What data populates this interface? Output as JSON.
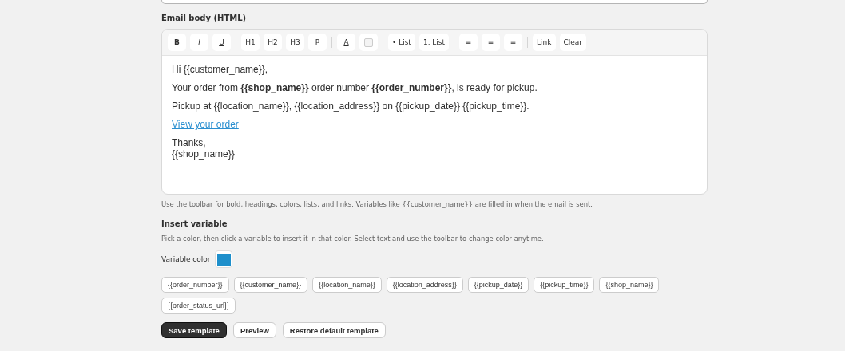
{
  "editor": {
    "label": "Email body (HTML)",
    "toolbar": [
      [
        {
          "label": "B",
          "kind": "bold"
        },
        {
          "label": "I",
          "kind": "italic"
        },
        {
          "label": "U",
          "kind": "underline"
        }
      ],
      [
        {
          "label": "H1",
          "kind": "text"
        },
        {
          "label": "H2",
          "kind": "text"
        },
        {
          "label": "H3",
          "kind": "text"
        },
        {
          "label": "P",
          "kind": "text"
        }
      ],
      [
        {
          "label": "A",
          "kind": "underline"
        },
        {
          "kind": "swatch"
        }
      ],
      [
        {
          "label": "• List",
          "kind": "text"
        },
        {
          "label": "1. List",
          "kind": "text"
        }
      ],
      [
        {
          "label": "≡",
          "kind": "text"
        },
        {
          "label": "≡",
          "kind": "text"
        },
        {
          "label": "≡",
          "kind": "text"
        }
      ],
      [
        {
          "label": "Link",
          "kind": "text"
        },
        {
          "label": "Clear",
          "kind": "text"
        }
      ]
    ],
    "body": [
      {
        "kind": "paragraph",
        "text": "Hi {{customer_name}},"
      },
      {
        "kind": "paragraph",
        "text": "Your order from **{{shop_name}}** order number **{{order_number}}**, is ready for pickup."
      },
      {
        "kind": "paragraph",
        "text": "Pickup at {{location_name}}, {{location_address}} on {{pickup_date}} {{pickup_time}}."
      },
      {
        "kind": "link",
        "text": "View your order"
      },
      {
        "kind": "lines",
        "lines": [
          "Thanks,",
          "{{shop_name}}"
        ]
      }
    ],
    "hint": "Use the toolbar for bold, headings, colors, lists, and links. Variables like {{customer_name}} are filled in when the email is sent."
  },
  "insert_variable": {
    "title": "Insert variable",
    "description": "Pick a color, then click a variable to insert it in that color. Select text and use the toolbar to change color anytime.",
    "color_label": "Variable color",
    "color": "#1e8fcb",
    "variables": [
      "{{order_number}}",
      "{{customer_name}}",
      "{{location_name}}",
      "{{location_address}}",
      "{{pickup_date}}",
      "{{pickup_time}}",
      "{{shop_name}}",
      "{{order_status_url}}"
    ]
  },
  "actions": [
    {
      "label": "Save template",
      "primary": true
    },
    {
      "label": "Preview",
      "primary": false
    },
    {
      "label": "Restore default template",
      "primary": false
    }
  ]
}
